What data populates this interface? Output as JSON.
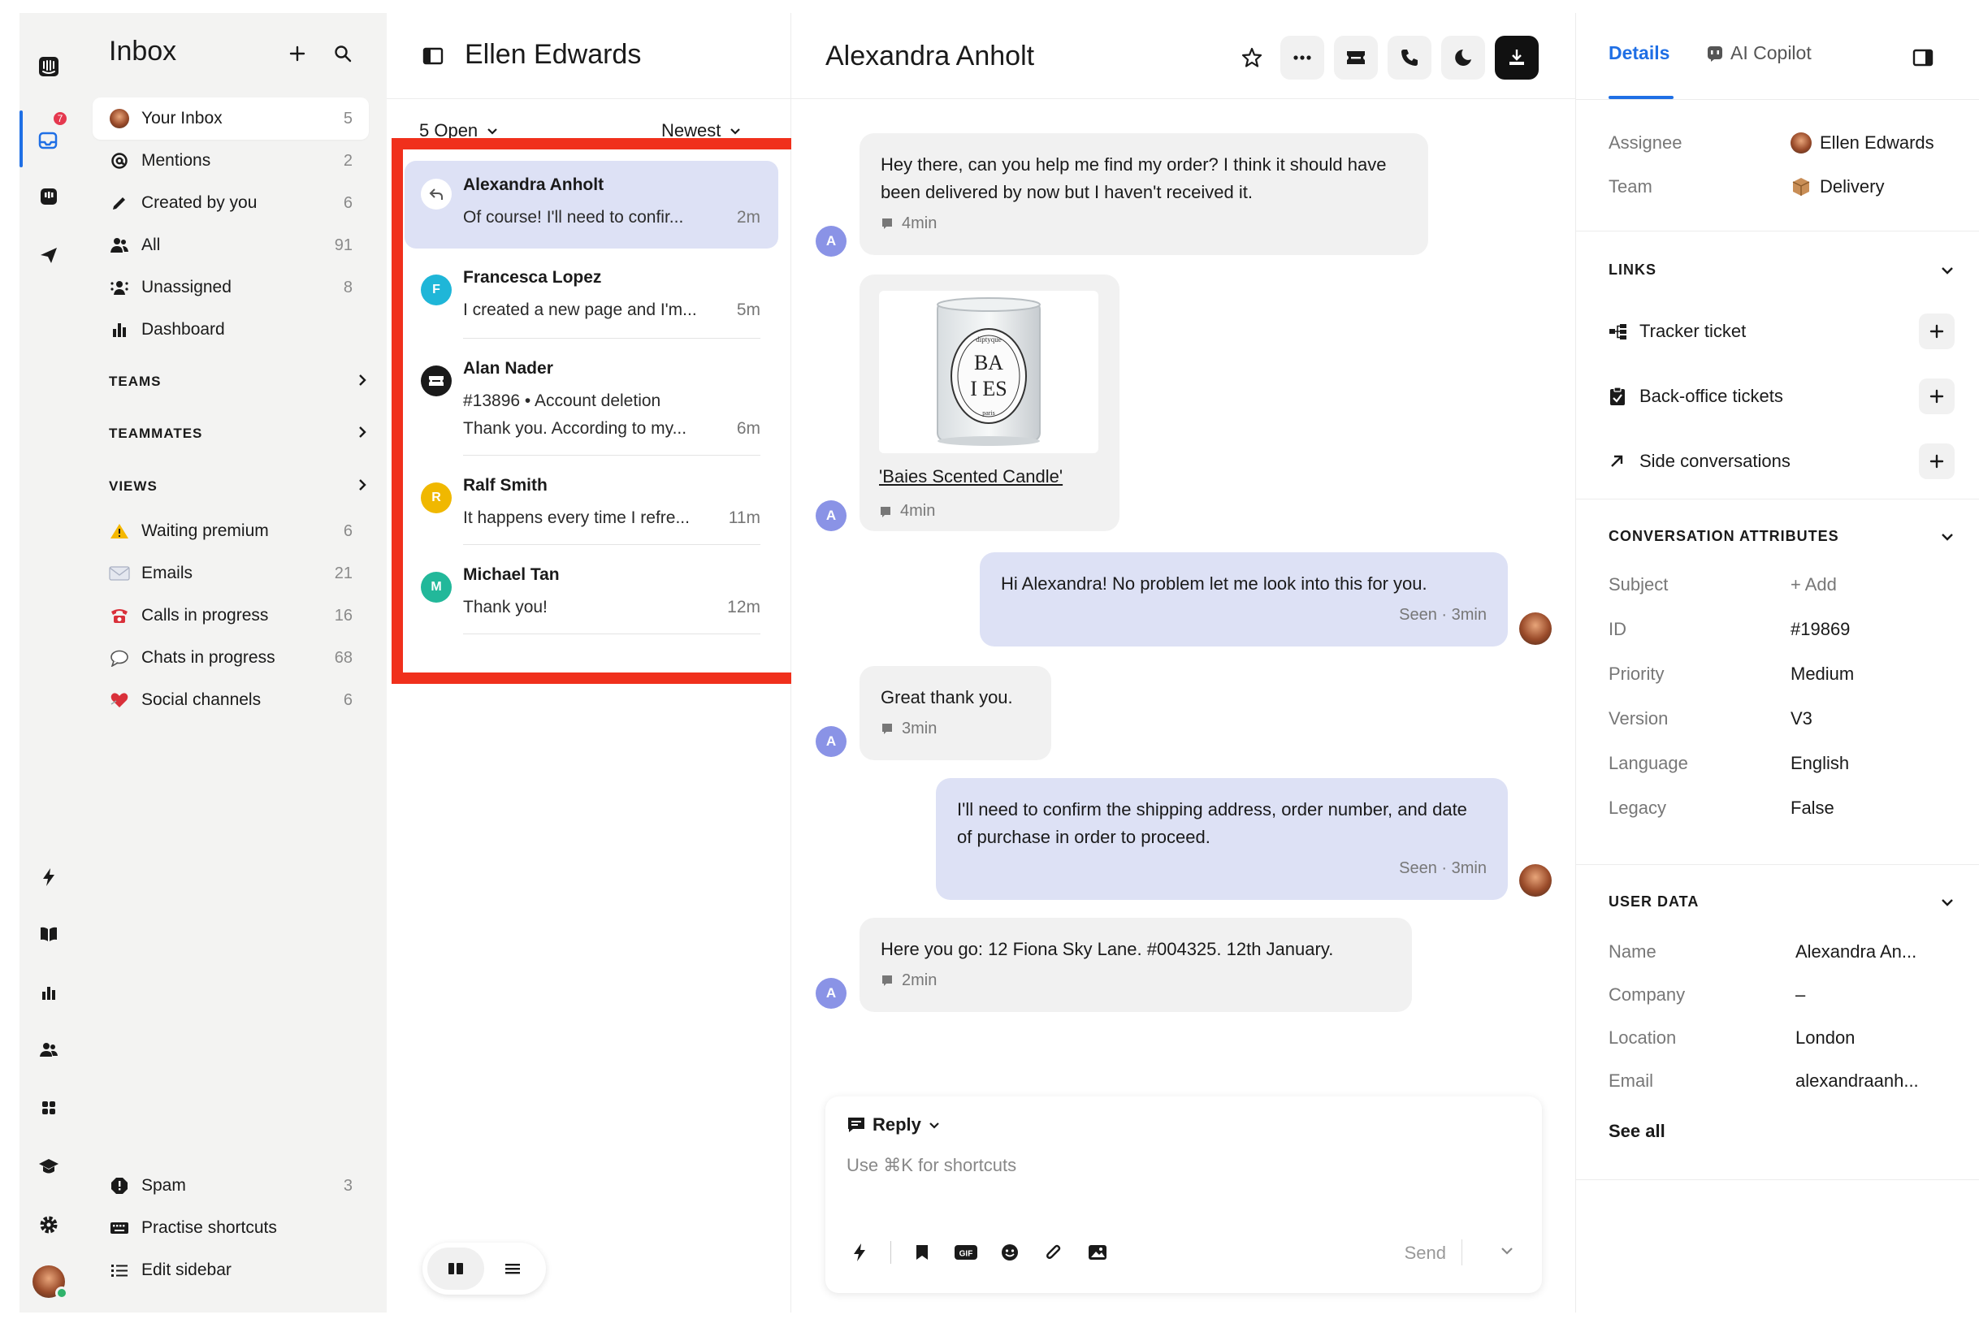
{
  "rail": {
    "badge": "7",
    "colors": {
      "active": "#1f6fe5",
      "badge": "#e5384f",
      "online": "#2fb36b"
    }
  },
  "sidebar": {
    "title": "Inbox",
    "items": [
      {
        "label": "Your Inbox",
        "count": "5",
        "icon": "avatar-icon"
      },
      {
        "label": "Mentions",
        "count": "2",
        "icon": "at-icon"
      },
      {
        "label": "Created by you",
        "count": "6",
        "icon": "pencil-icon"
      },
      {
        "label": "All",
        "count": "91",
        "icon": "people-icon"
      },
      {
        "label": "Unassigned",
        "count": "8",
        "icon": "unassigned-icon"
      },
      {
        "label": "Dashboard",
        "count": "",
        "icon": "bar-chart-icon"
      }
    ],
    "sections": {
      "teams": "TEAMS",
      "teammates": "TEAMMATES",
      "views": "VIEWS"
    },
    "views": [
      {
        "label": "Waiting premium",
        "count": "6",
        "icon": "warning-icon"
      },
      {
        "label": "Emails",
        "count": "21",
        "icon": "envelope-icon"
      },
      {
        "label": "Calls in progress",
        "count": "16",
        "icon": "telephone-icon"
      },
      {
        "label": "Chats in progress",
        "count": "68",
        "icon": "speech-bubble-icon"
      },
      {
        "label": "Social channels",
        "count": "6",
        "icon": "heart-icon"
      }
    ],
    "bottom": [
      {
        "label": "Spam",
        "count": "3",
        "icon": "spam-icon"
      },
      {
        "label": "Practise shortcuts",
        "count": "",
        "icon": "keyboard-icon"
      },
      {
        "label": "Edit sidebar",
        "count": "",
        "icon": "list-icon"
      }
    ]
  },
  "list": {
    "title": "Ellen Edwards",
    "filter_open": "5 Open",
    "filter_sort": "Newest",
    "conversations": [
      {
        "name": "Alexandra Anholt",
        "line1": "Of course! I'll need to confir...",
        "line2": "",
        "time": "2m",
        "avatar": "",
        "avatar_color": "#ffffff"
      },
      {
        "name": "Francesca Lopez",
        "line1": "I created a new page and I'm...",
        "line2": "",
        "time": "5m",
        "avatar": "F",
        "avatar_color": "#1fb6d8"
      },
      {
        "name": "Alan Nader",
        "line1": "#13896 • Account deletion",
        "line2": "Thank you. According to my...",
        "time": "6m",
        "avatar": "",
        "avatar_color": "#1a1a1a"
      },
      {
        "name": "Ralf Smith",
        "line1": "It happens every time I refre...",
        "line2": "",
        "time": "11m",
        "avatar": "R",
        "avatar_color": "#f0b800"
      },
      {
        "name": "Michael Tan",
        "line1": "Thank you!",
        "line2": "",
        "time": "12m",
        "avatar": "M",
        "avatar_color": "#22b89a"
      }
    ],
    "highlight_color": "#f0301c"
  },
  "conversation": {
    "title": "Alexandra Anholt",
    "avatar_letter": "A",
    "messages": [
      {
        "text": "Hey there, can you help me find my order? I think it should have been delivered by now but I haven't received it.",
        "meta": "4min"
      },
      {
        "link": "'Baies Scented Candle'",
        "meta": "4min"
      },
      {
        "text": "Hi Alexandra! No problem let me look into this for you.",
        "meta": "Seen · 3min"
      },
      {
        "text": "Great thank you.",
        "meta": "3min"
      },
      {
        "text": "I'll need to confirm the shipping address, order number, and date of purchase in order to proceed.",
        "meta": "Seen · 3min"
      },
      {
        "text": "Here you go: 12 Fiona Sky Lane. #004325. 12th January.",
        "meta": "2min"
      }
    ],
    "candle_label": {
      "top": "diptyque",
      "line1": "BA",
      "line2": "I  ES",
      "bottom": "paris"
    },
    "composer": {
      "mode": "Reply",
      "placeholder": "Use ⌘K for shortcuts",
      "gif": "GIF",
      "send": "Send"
    }
  },
  "details": {
    "tabs": [
      "Details",
      "AI Copilot"
    ],
    "assignee_label": "Assignee",
    "assignee_value": "Ellen Edwards",
    "team_label": "Team",
    "team_value": "Delivery",
    "links_title": "LINKS",
    "links": [
      "Tracker ticket",
      "Back-office tickets",
      "Side conversations"
    ],
    "attributes_title": "CONVERSATION ATTRIBUTES",
    "attributes": [
      {
        "k": "Subject",
        "v": "+ Add"
      },
      {
        "k": "ID",
        "v": "#19869"
      },
      {
        "k": "Priority",
        "v": "Medium"
      },
      {
        "k": "Version",
        "v": "V3"
      },
      {
        "k": "Language",
        "v": "English"
      },
      {
        "k": "Legacy",
        "v": "False"
      }
    ],
    "user_title": "USER DATA",
    "user": [
      {
        "k": "Name",
        "v": "Alexandra An..."
      },
      {
        "k": "Company",
        "v": "–"
      },
      {
        "k": "Location",
        "v": "London"
      },
      {
        "k": "Email",
        "v": "alexandraanh..."
      }
    ],
    "see_all": "See all"
  }
}
